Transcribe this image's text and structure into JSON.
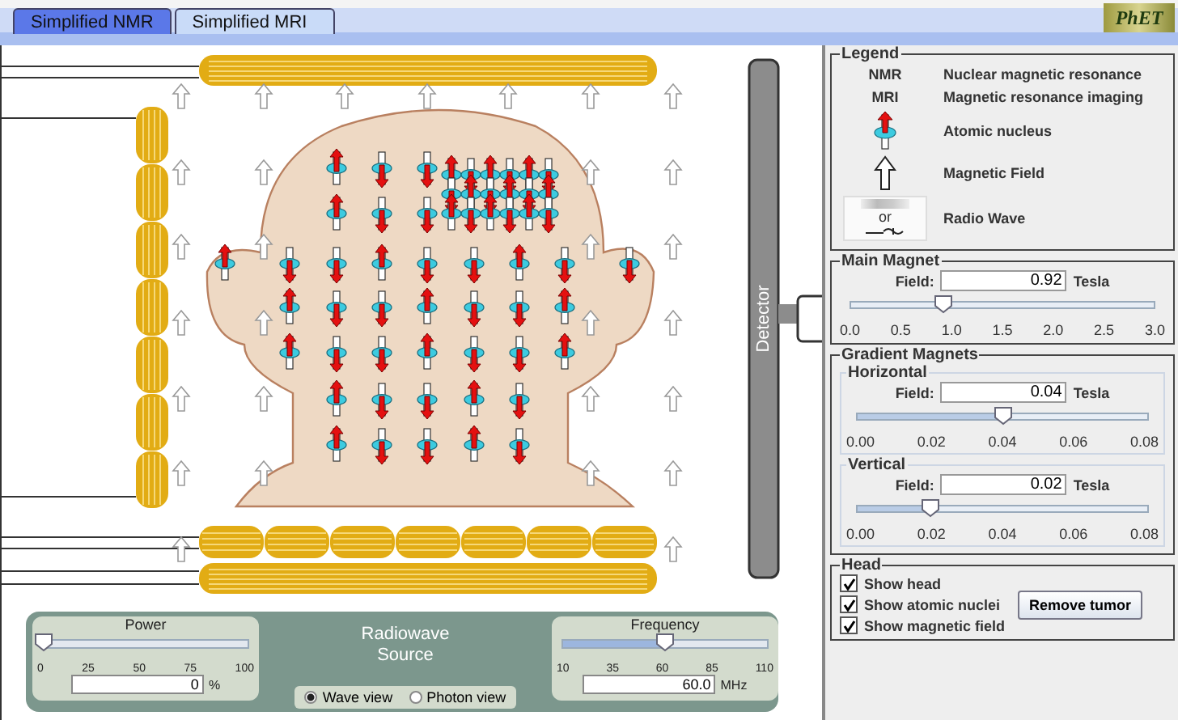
{
  "tabs": [
    {
      "label": "Simplified NMR",
      "selected": false
    },
    {
      "label": "Simplified MRI",
      "selected": true
    }
  ],
  "logo": "PhET",
  "canvas": {
    "detector_label": "Detector"
  },
  "radiowave_source": {
    "title": "Radiowave Source",
    "power": {
      "title": "Power",
      "level": 0,
      "ticks": [
        "0",
        "25",
        "50",
        "75",
        "100"
      ],
      "value": "0",
      "unit": "%"
    },
    "views": [
      {
        "label": "Wave view",
        "selected": true
      },
      {
        "label": "Photon view",
        "selected": false
      }
    ],
    "frequency": {
      "title": "Frequency",
      "level": 0.5,
      "ticks": [
        "10",
        "35",
        "60",
        "85",
        "110"
      ],
      "value": "60.0",
      "unit": "MHz"
    }
  },
  "legend": {
    "title": "Legend",
    "items": [
      {
        "kind": "abbreviation",
        "symbol": "NMR",
        "text": "Nuclear magnetic resonance"
      },
      {
        "kind": "abbreviation",
        "symbol": "MRI",
        "text": "Magnetic resonance imaging"
      },
      {
        "kind": "nucleus",
        "text": "Atomic nucleus"
      },
      {
        "kind": "field",
        "text": "Magnetic Field"
      },
      {
        "kind": "radio-wave",
        "or_label": "or",
        "text": "Radio Wave"
      }
    ]
  },
  "main_magnet": {
    "title": "Main Magnet",
    "field_label": "Field:",
    "value": "0.92",
    "unit": "Tesla",
    "level": 0.307,
    "ticks": [
      "0.0",
      "0.5",
      "1.0",
      "1.5",
      "2.0",
      "2.5",
      "3.0"
    ]
  },
  "gradient_magnets": {
    "title": "Gradient Magnets",
    "magnets": [
      {
        "title": "Horizontal",
        "field_label": "Field:",
        "value": "0.04",
        "unit": "Tesla",
        "level": 0.5,
        "ticks": [
          "0.00",
          "0.02",
          "0.04",
          "0.06",
          "0.08"
        ]
      },
      {
        "title": "Vertical",
        "field_label": "Field:",
        "value": "0.02",
        "unit": "Tesla",
        "level": 0.25,
        "ticks": [
          "0.00",
          "0.02",
          "0.04",
          "0.06",
          "0.08"
        ]
      }
    ]
  },
  "head": {
    "title": "Head",
    "options": [
      {
        "label": "Show head",
        "checked": true
      },
      {
        "label": "Show atomic nuclei",
        "checked": true
      },
      {
        "label": "Show magnetic field",
        "checked": true
      }
    ],
    "button": "Remove tumor"
  }
}
